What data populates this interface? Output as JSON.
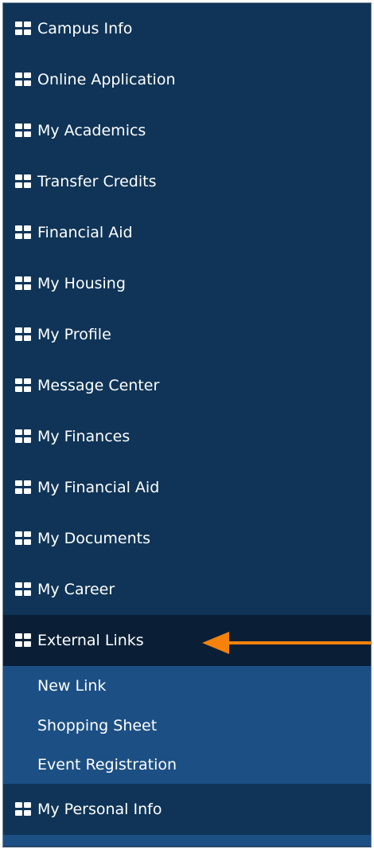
{
  "menu": {
    "items": [
      {
        "label": "Campus Info"
      },
      {
        "label": "Online Application"
      },
      {
        "label": "My Academics"
      },
      {
        "label": "Transfer Credits"
      },
      {
        "label": "Financial Aid"
      },
      {
        "label": "My Housing"
      },
      {
        "label": "My Profile"
      },
      {
        "label": "Message Center"
      },
      {
        "label": "My Finances"
      },
      {
        "label": "My Financial Aid"
      },
      {
        "label": "My Documents"
      },
      {
        "label": "My Career"
      },
      {
        "label": "External Links"
      }
    ],
    "submenu": [
      {
        "label": "New Link"
      },
      {
        "label": "Shopping Sheet"
      },
      {
        "label": "Event Registration"
      }
    ],
    "after": [
      {
        "label": "My Personal Info"
      }
    ]
  },
  "colors": {
    "menu_bg": "#0f3457",
    "active_bg": "#0a1f36",
    "submenu_bg": "#1c4f84",
    "arrow": "#f5820a"
  },
  "icons": {
    "menu_item": "grid-icon",
    "annotation": "arrow-left-icon"
  }
}
